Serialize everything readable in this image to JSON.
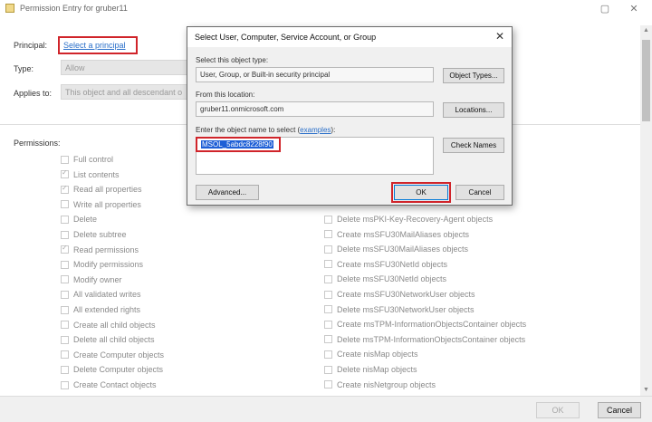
{
  "window": {
    "title": "Permission Entry for gruber11",
    "minimize": "▢",
    "close": "✕"
  },
  "top": {
    "principal_label": "Principal:",
    "principal_link": "Select a principal",
    "type_label": "Type:",
    "type_value": "Allow",
    "applies_label": "Applies to:",
    "applies_value": "This object and all descendant o"
  },
  "permissions": {
    "heading": "Permissions:",
    "left": [
      {
        "label": "Full control",
        "checked": false
      },
      {
        "label": "List contents",
        "checked": true
      },
      {
        "label": "Read all properties",
        "checked": true
      },
      {
        "label": "Write all properties",
        "checked": false
      },
      {
        "label": "Delete",
        "checked": false
      },
      {
        "label": "Delete subtree",
        "checked": false
      },
      {
        "label": "Read permissions",
        "checked": true
      },
      {
        "label": "Modify permissions",
        "checked": false
      },
      {
        "label": "Modify owner",
        "checked": false
      },
      {
        "label": "All validated writes",
        "checked": false
      },
      {
        "label": "All extended rights",
        "checked": false
      },
      {
        "label": "Create all child objects",
        "checked": false
      },
      {
        "label": "Delete all child objects",
        "checked": false
      },
      {
        "label": "Create Computer objects",
        "checked": false
      },
      {
        "label": "Delete Computer objects",
        "checked": false
      },
      {
        "label": "Create Contact objects",
        "checked": false
      }
    ],
    "right": [
      {
        "label": "Delete msPKI-Key-Recovery-Agent objects",
        "checked": false
      },
      {
        "label": "Create msSFU30MailAliases objects",
        "checked": false
      },
      {
        "label": "Delete msSFU30MailAliases objects",
        "checked": false
      },
      {
        "label": "Create msSFU30NetId objects",
        "checked": false
      },
      {
        "label": "Delete msSFU30NetId objects",
        "checked": false
      },
      {
        "label": "Create msSFU30NetworkUser objects",
        "checked": false
      },
      {
        "label": "Delete msSFU30NetworkUser objects",
        "checked": false
      },
      {
        "label": "Create msTPM-InformationObjectsContainer objects",
        "checked": false
      },
      {
        "label": "Delete msTPM-InformationObjectsContainer objects",
        "checked": false
      },
      {
        "label": "Create nisMap objects",
        "checked": false
      },
      {
        "label": "Delete nisMap objects",
        "checked": false
      },
      {
        "label": "Create nisNetgroup objects",
        "checked": false
      }
    ]
  },
  "footer": {
    "ok": "OK",
    "cancel": "Cancel"
  },
  "dialog": {
    "title": "Select User, Computer, Service Account, or Group",
    "close": "✕",
    "object_type_label": "Select this object type:",
    "object_type_value": "User, Group, or Built-in security principal",
    "object_types_button": "Object Types...",
    "location_label": "From this location:",
    "location_value": "gruber11.onmicrosoft.com",
    "locations_button": "Locations...",
    "enter_label": "Enter the object name to select (",
    "examples_link": "examples",
    "enter_label_end": "):",
    "object_name": "MSOL_5abdc8228f90",
    "check_names_button": "Check Names",
    "advanced_button": "Advanced...",
    "ok_button": "OK",
    "cancel_button": "Cancel"
  },
  "colors": {
    "highlight": "#d0242a",
    "link": "#2a6fc9",
    "selection": "#1e5fd6"
  }
}
